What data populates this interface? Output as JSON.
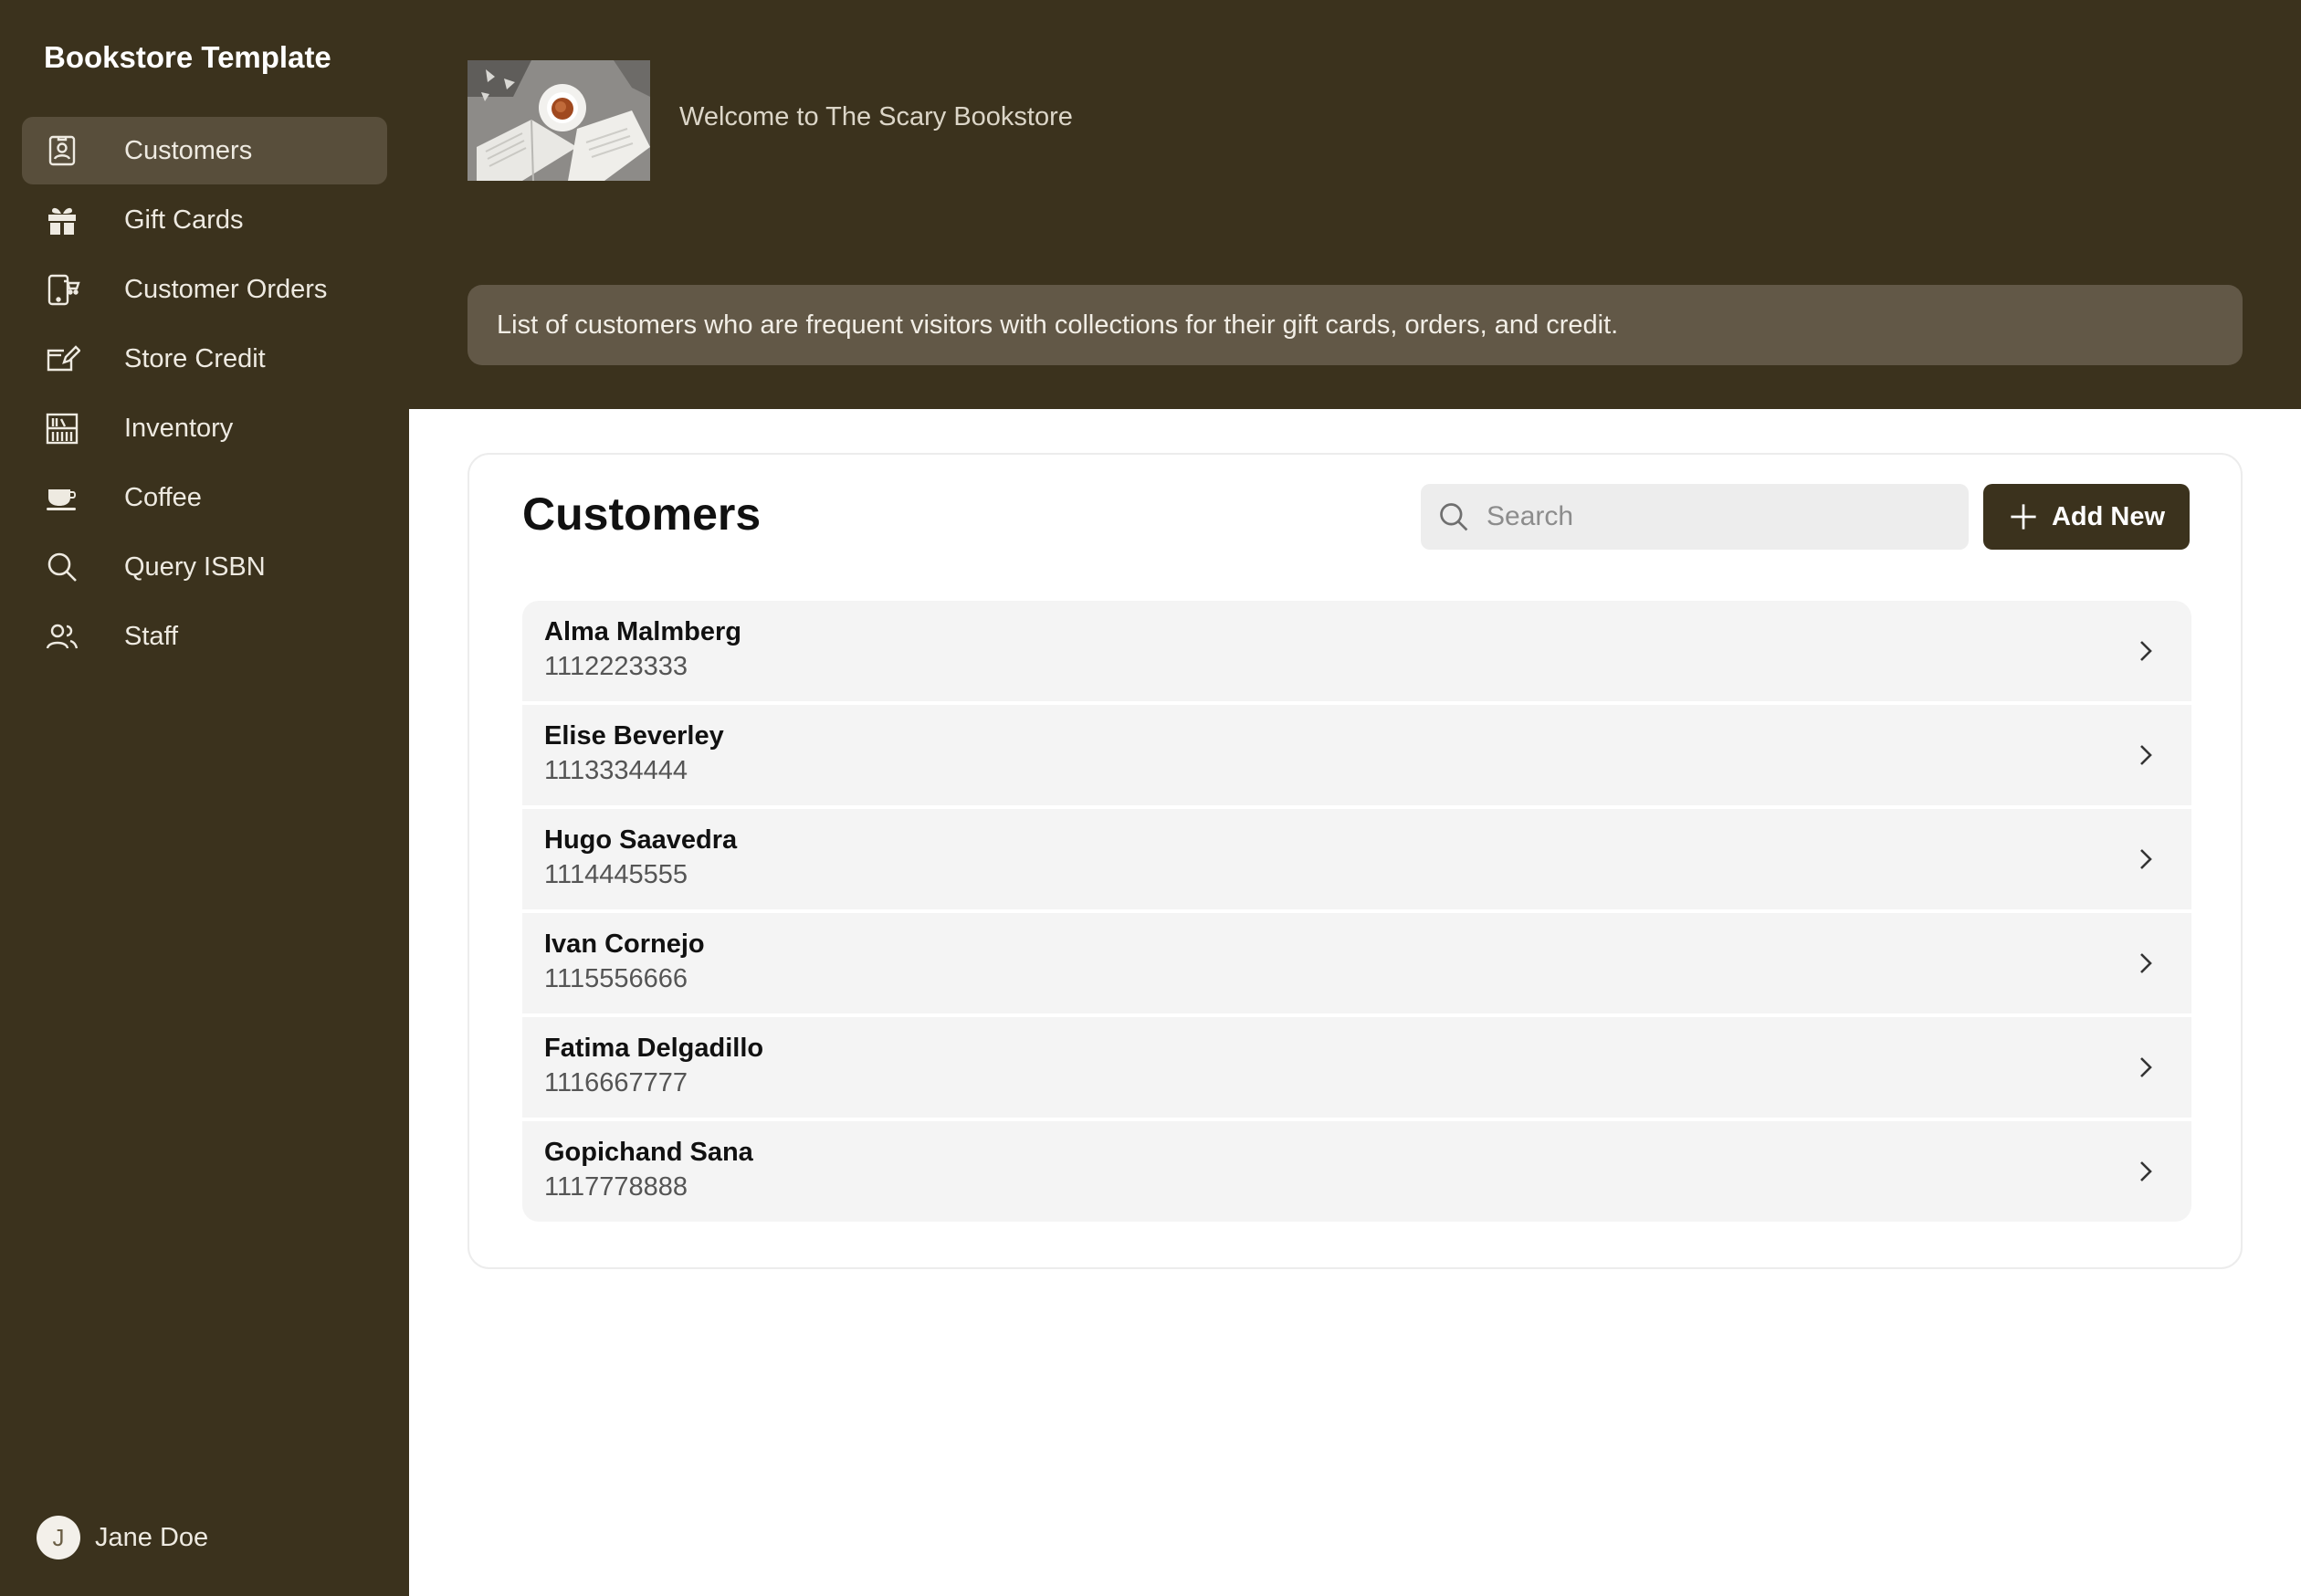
{
  "sidebar": {
    "brand": "Bookstore Template",
    "items": [
      {
        "label": "Customers",
        "icon": "customers-icon",
        "active": true
      },
      {
        "label": "Gift Cards",
        "icon": "gift-icon"
      },
      {
        "label": "Customer Orders",
        "icon": "phone-cart-icon"
      },
      {
        "label": "Store Credit",
        "icon": "edit-card-icon"
      },
      {
        "label": "Inventory",
        "icon": "shelves-icon"
      },
      {
        "label": "Coffee",
        "icon": "coffee-cup-icon"
      },
      {
        "label": "Query ISBN",
        "icon": "search-icon"
      },
      {
        "label": "Staff",
        "icon": "people-icon"
      }
    ],
    "user": {
      "initial": "J",
      "name": "Jane Doe"
    }
  },
  "hero": {
    "welcome": "Welcome to The Scary Bookstore",
    "description": "List of customers who are frequent visitors with collections for their gift cards, orders, and credit."
  },
  "main": {
    "title": "Customers",
    "search_placeholder": "Search",
    "add_label": "Add New",
    "customers": [
      {
        "name": "Alma Malmberg",
        "phone": "1112223333"
      },
      {
        "name": "Elise Beverley",
        "phone": "1113334444"
      },
      {
        "name": "Hugo Saavedra",
        "phone": "1114445555"
      },
      {
        "name": "Ivan Cornejo",
        "phone": "1115556666"
      },
      {
        "name": "Fatima Delgadillo",
        "phone": "1116667777"
      },
      {
        "name": "Gopichand Sana",
        "phone": "1117778888"
      }
    ]
  },
  "colors": {
    "sidebar": "#3b321d",
    "active_item": "#584e3b",
    "accent": "#3b321d",
    "row_bg": "#f4f4f4"
  }
}
